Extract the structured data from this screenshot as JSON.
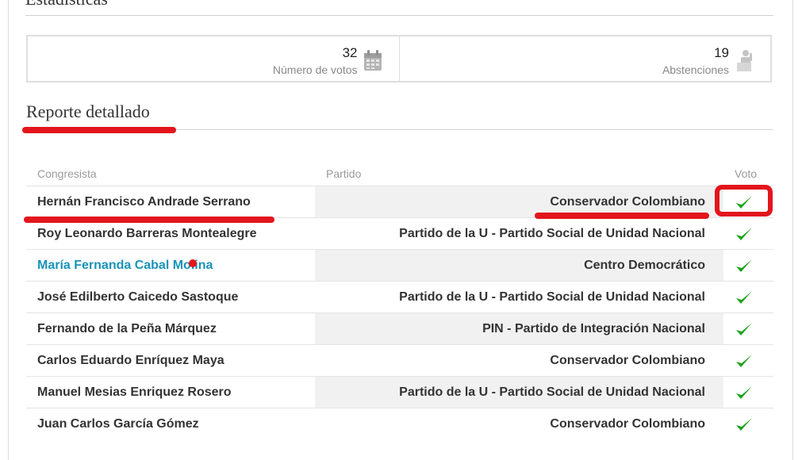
{
  "header": {
    "section_title": "Estadísticas"
  },
  "stats": [
    {
      "value": "32",
      "label": "Número de votos",
      "icon": "calendar-icon"
    },
    {
      "value": "19",
      "label": "Abstenciones",
      "icon": "person-icon"
    }
  ],
  "report": {
    "title": "Reporte detallado",
    "columns": {
      "name": "Congresista",
      "party": "Partido",
      "vote": "Voto"
    },
    "rows": [
      {
        "name": "Hernán Francisco Andrade Serrano",
        "party": "Conservador Colombiano",
        "vote": "check-icon"
      },
      {
        "name": "Roy Leonardo Barreras Montealegre",
        "party": "Partido de la U - Partido Social de Unidad Nacional",
        "vote": "check-icon"
      },
      {
        "name": "María Fernanda Cabal Molina",
        "party": "Centro Democrático",
        "vote": "check-icon"
      },
      {
        "name": "José Edilberto Caicedo Sastoque",
        "party": "Partido de la U - Partido Social de Unidad Nacional",
        "vote": "check-icon"
      },
      {
        "name": "Fernando de la Peña Márquez",
        "party": "PIN - Partido de Integración Nacional",
        "vote": "check-icon"
      },
      {
        "name": "Carlos Eduardo Enríquez Maya",
        "party": "Conservador Colombiano",
        "vote": "check-icon"
      },
      {
        "name": "Manuel Mesias Enriquez Rosero",
        "party": "Partido de la U - Partido Social de Unidad Nacional",
        "vote": "check-icon"
      },
      {
        "name": "Juan Carlos García Gómez",
        "party": "Conservador Colombiano",
        "vote": "check-icon"
      }
    ]
  },
  "colors": {
    "accent_link": "#1a93b8",
    "check_green": "#1aa31a",
    "annotation_red": "#e2161c"
  }
}
